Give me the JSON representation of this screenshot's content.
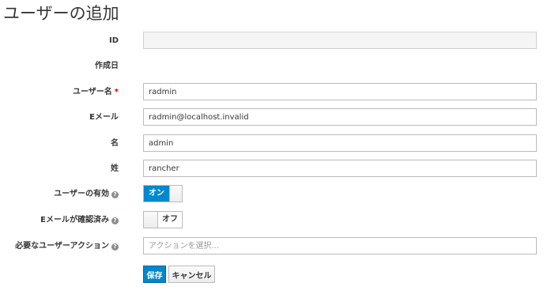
{
  "page": {
    "title": "ユーザーの追加"
  },
  "form": {
    "id": {
      "label": "ID",
      "value": ""
    },
    "created": {
      "label": "作成日"
    },
    "username": {
      "label": "ユーザー名",
      "required_mark": "*",
      "value": "radmin"
    },
    "email": {
      "label": "Eメール",
      "value": "radmin@localhost.invalid"
    },
    "first_name": {
      "label": "名",
      "value": "admin"
    },
    "last_name": {
      "label": "姓",
      "value": "rancher"
    },
    "user_enabled": {
      "label": "ユーザーの有効",
      "state_label": "オン",
      "enabled": true
    },
    "email_verified": {
      "label": "Eメールが確認済み",
      "state_label": "オフ",
      "enabled": false
    },
    "required_actions": {
      "label": "必要なユーザーアクション",
      "placeholder": "アクションを選択..."
    }
  },
  "icons": {
    "help": "help-circle-icon"
  },
  "help_glyph": "?",
  "buttons": {
    "save": "保存",
    "cancel": "キャンセル"
  },
  "colors": {
    "primary": "#0088ce",
    "required": "#cc0000"
  }
}
